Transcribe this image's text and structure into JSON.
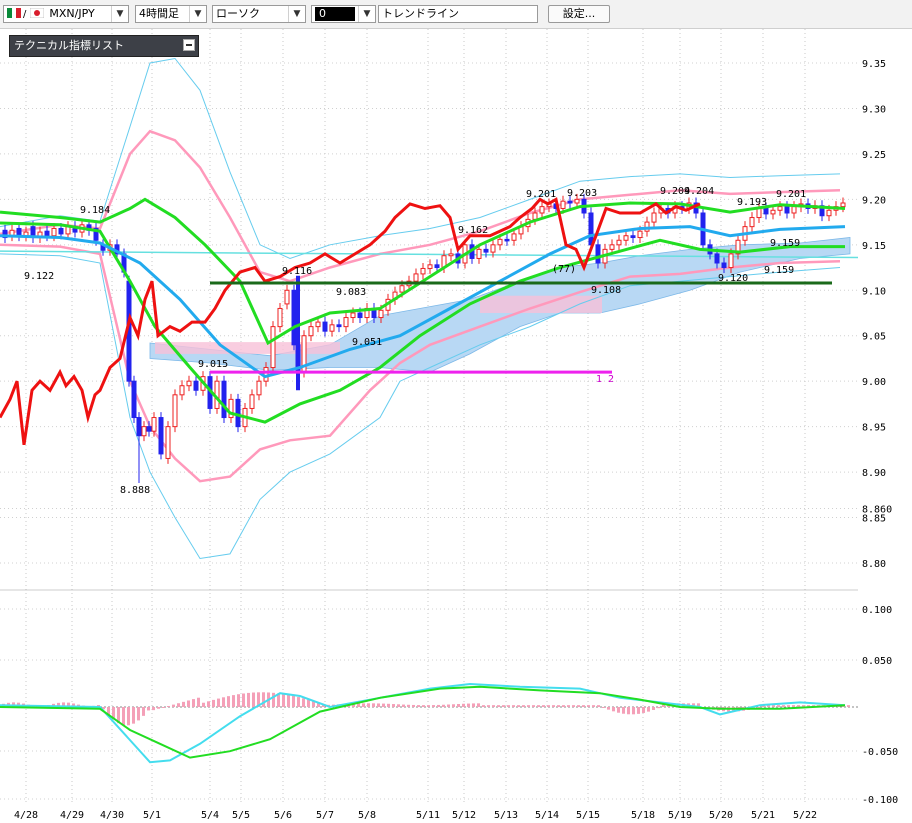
{
  "toolbar": {
    "symbol": "MXN/JPY",
    "timeframe": "4時間足",
    "chart_style": "ローソク",
    "tool_value": "0",
    "drawing": "トレンドライン",
    "settings_label": "設定..."
  },
  "indicator_panel": {
    "title": "テクニカル指標リスト"
  },
  "price_axis": [
    "9.35",
    "9.30",
    "9.25",
    "9.20",
    "9.15",
    "9.10",
    "9.05",
    "9.00",
    "8.95",
    "8.90",
    "8.860",
    "8.85",
    "8.80"
  ],
  "osc_axis": [
    "0.100",
    "0.050",
    "-0.050",
    "-0.100"
  ],
  "date_axis": [
    "4/28",
    "4/29",
    "4/30",
    "5/1",
    "5/4",
    "5/5",
    "5/6",
    "5/7",
    "5/8",
    "5/11",
    "5/12",
    "5/13",
    "5/14",
    "5/15",
    "5/18",
    "5/19",
    "5/20",
    "5/21",
    "5/22"
  ],
  "annotations": [
    "9.184",
    "9.122",
    "8.888",
    "9.015",
    "9.116",
    "9.083",
    "9.051",
    "9.162",
    "9.201",
    "9.203",
    "(77)",
    "9.108",
    "9.204",
    "9.204",
    "9.193",
    "9.201",
    "9.159",
    "9.159",
    "9.120",
    "1 2"
  ],
  "colors": {
    "bb_outer": "#66ccee",
    "bb_inner": "#ff99bb",
    "ma_green": "#22dd22",
    "ma_blue": "#22aaee",
    "red_line": "#ee1111",
    "cloud": "#b8d8f4",
    "cloud_neg": "#f8c0d8",
    "support": "#1a6a1a",
    "magenta_line": "#ee22ee",
    "bull_candle": "#ee2222",
    "bear_candle": "#2222ee"
  },
  "chart_data": {
    "type": "line",
    "instrument": "MXN/JPY",
    "timeframe": "4時間足",
    "x": [
      "4/28",
      "4/29",
      "4/30",
      "5/1",
      "5/4",
      "5/5",
      "5/6",
      "5/7",
      "5/8",
      "5/11",
      "5/12",
      "5/13",
      "5/14",
      "5/15",
      "5/18",
      "5/19",
      "5/20",
      "5/21",
      "5/22"
    ],
    "ylim": [
      8.86,
      9.36
    ],
    "series": [
      {
        "values": [
          9.17,
          9.16,
          9.15,
          9.04,
          8.95,
          9.0,
          9.08,
          9.1,
          9.12,
          9.15,
          9.16,
          9.17,
          9.19,
          9.19,
          9.19,
          9.19,
          9.16,
          9.17,
          9.19
        ]
      }
    ],
    "levels": [
      {
        "label": "9.108",
        "value": 9.108
      },
      {
        "label": "9.015",
        "value": 9.015
      }
    ],
    "price_labels": [
      "9.184",
      "9.122",
      "8.888",
      "9.015",
      "9.116",
      "9.083",
      "9.051",
      "9.162",
      "9.201",
      "9.203",
      "9.204",
      "9.204",
      "9.193",
      "9.201",
      "9.159",
      "9.159",
      "9.120"
    ]
  }
}
